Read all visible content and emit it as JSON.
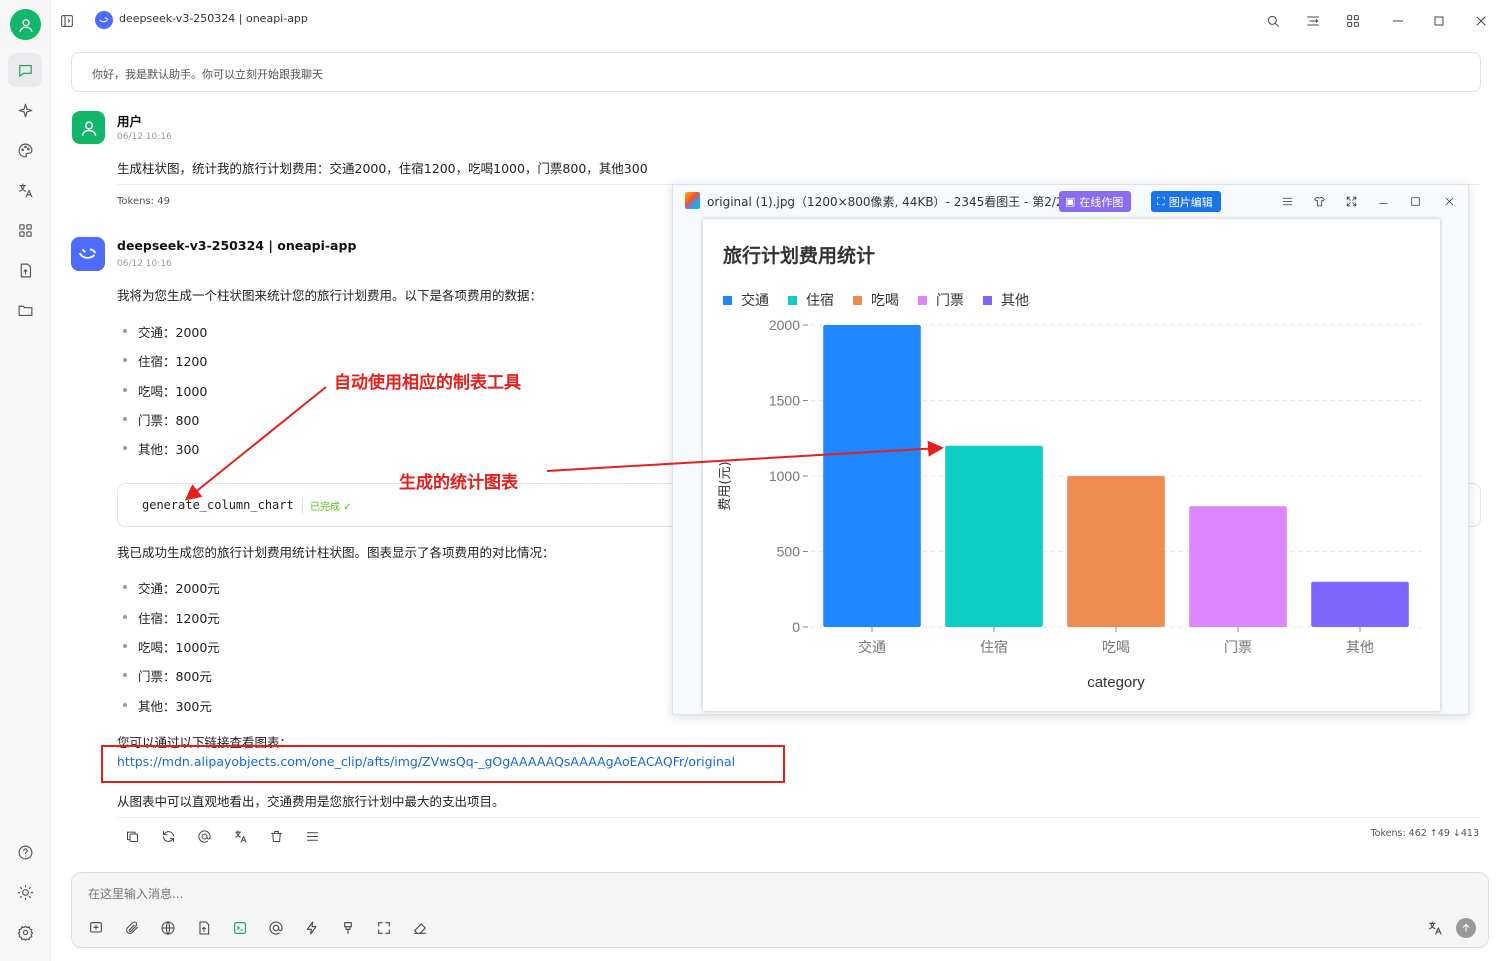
{
  "window": {
    "title": "deepseek-v3-250324 | oneapi-app"
  },
  "greeting": "你好，我是默认助手。你可以立刻开始跟我聊天",
  "user_msg": {
    "name": "用户",
    "time": "06/12 10:16",
    "text": "生成柱状图，统计我的旅行计划费用：交通2000，住宿1200，吃喝1000，门票800，其他300",
    "tokens": "Tokens: 49"
  },
  "assistant_msg": {
    "name": "deepseek-v3-250324 | oneapi-app",
    "time": "06/12 10:16",
    "intro": "我将为您生成一个柱状图来统计您的旅行计划费用。以下是各项费用的数据：",
    "items1": [
      "交通：2000",
      "住宿：1200",
      "吃喝：1000",
      "门票：800",
      "其他：300"
    ],
    "tool_name": "generate_column_chart",
    "tool_status": "已完成 ✓",
    "done": "我已成功生成您的旅行计划费用统计柱状图。图表显示了各项费用的对比情况：",
    "items2": [
      "交通：2000元",
      "住宿：1200元",
      "吃喝：1000元",
      "门票：800元",
      "其他：300元"
    ],
    "link_intro": "您可以通过以下链接查看图表：",
    "link": "https://mdn.alipayobjects.com/one_clip/afts/img/ZVwsQq-_gOgAAAAAQsAAAAgAoEACAQFr/original",
    "conclusion": "从图表中可以直观地看出，交通费用是您旅行计划中最大的支出项目。",
    "tokens": "Tokens: 462 ↑49 ↓413"
  },
  "input": {
    "placeholder": "在这里输入消息..."
  },
  "annotations": {
    "tool": "自动使用相应的制表工具",
    "chart": "生成的统计图表"
  },
  "viewer": {
    "title": "original (1).jpg（1200×800像素, 44KB）- 2345看图王 - 第2/25",
    "btn_online": "在线作图",
    "btn_edit": "图片编辑"
  },
  "chart_data": {
    "type": "bar",
    "title": "旅行计划费用统计",
    "categories": [
      "交通",
      "住宿",
      "吃喝",
      "门票",
      "其他"
    ],
    "values": [
      2000,
      1200,
      1000,
      800,
      300
    ],
    "colors": [
      "#1f87ff",
      "#0ecdc7",
      "#ef8c52",
      "#dc86ff",
      "#7e66ff"
    ],
    "legend": [
      "交通",
      "住宿",
      "吃喝",
      "门票",
      "其他"
    ],
    "legend_position": "top-left",
    "xlabel": "category",
    "ylabel": "费用(元)",
    "ylim": [
      0,
      2000
    ],
    "yticks": [
      0,
      500,
      1000,
      1500,
      2000
    ],
    "grid": true
  },
  "colors": {
    "accent": "#12b76a",
    "link": "#1668dc",
    "annotation": "#e5201b"
  }
}
